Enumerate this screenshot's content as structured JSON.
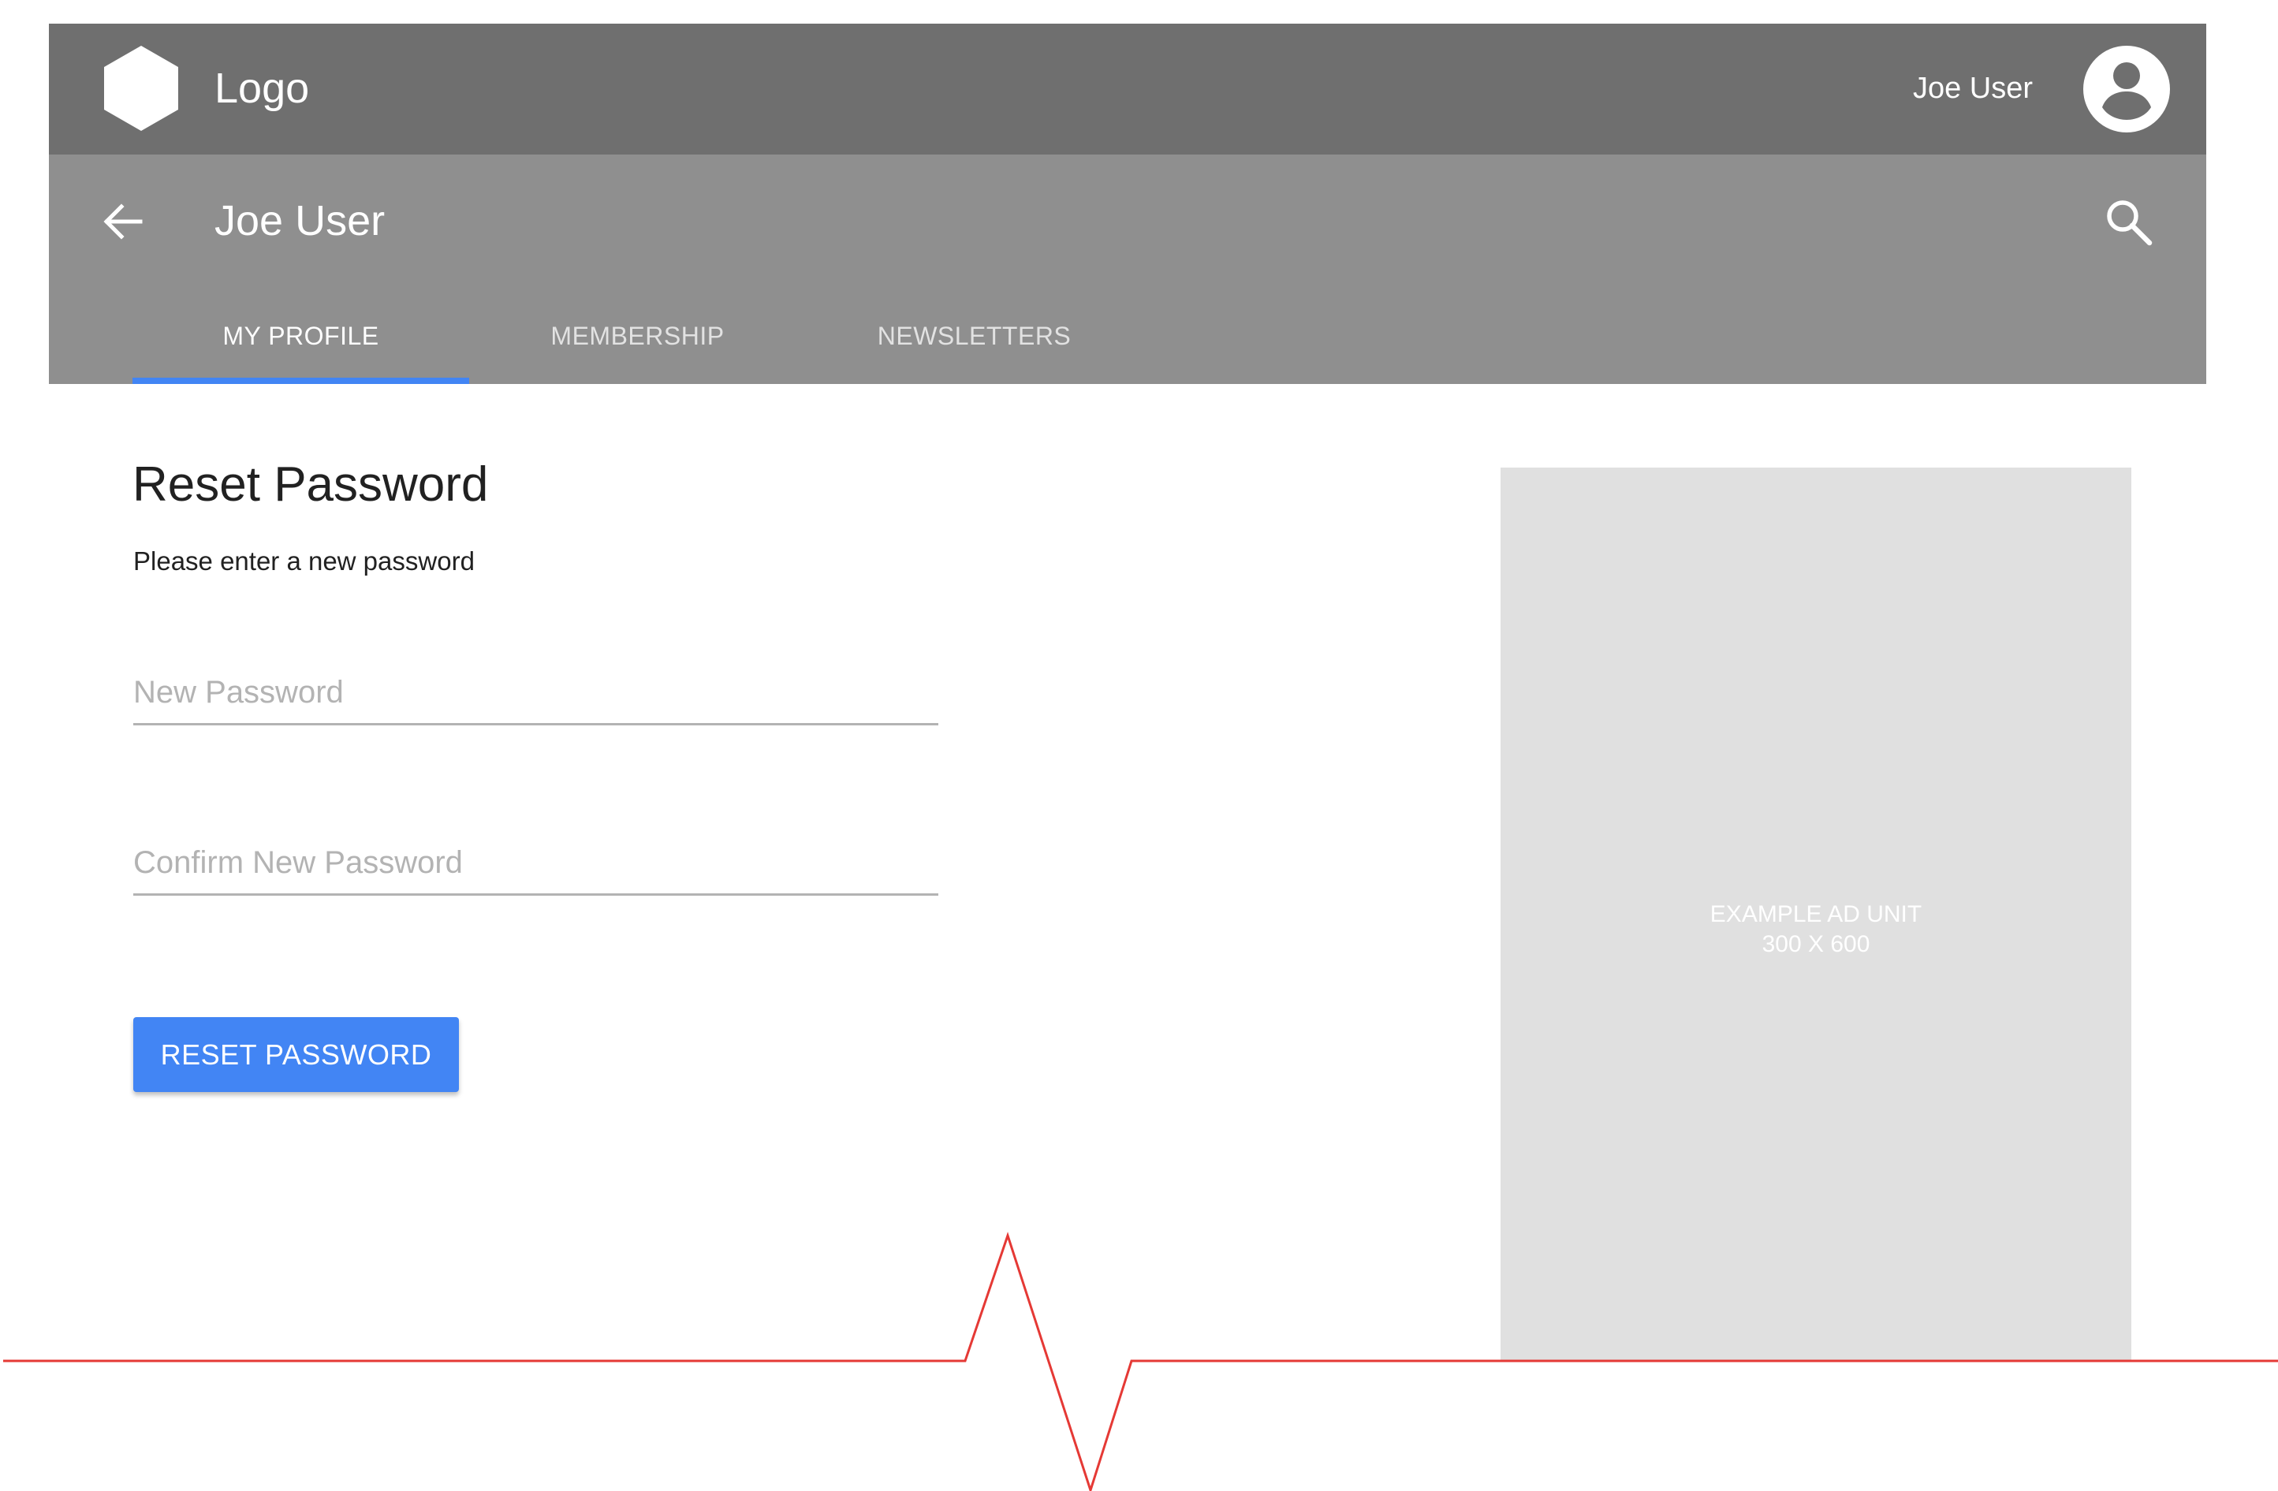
{
  "header": {
    "logo_label": "Logo",
    "user_name": "Joe User"
  },
  "sub_header": {
    "title": "Joe User"
  },
  "tabs": [
    {
      "label": "MY PROFILE",
      "active": true
    },
    {
      "label": "MEMBERSHIP",
      "active": false
    },
    {
      "label": "NEWSLETTERS",
      "active": false
    }
  ],
  "form": {
    "title": "Reset Password",
    "subtitle": "Please enter a new password",
    "new_password_placeholder": "New Password",
    "new_password_value": "",
    "confirm_password_placeholder": "Confirm New Password",
    "confirm_password_value": "",
    "submit_label": "RESET PASSWORD"
  },
  "ad": {
    "line1": "EXAMPLE AD UNIT",
    "line2": "300 X 600"
  },
  "icons": {
    "logo": "hexagon-icon",
    "avatar": "account-circle-icon",
    "back": "arrow-left-icon",
    "search": "search-icon"
  },
  "colors": {
    "top_bar": "#6f6f6f",
    "sub_bar": "#8f8f8f",
    "accent": "#4285f4",
    "ad_background": "#e0e0e0",
    "fold_line": "#e53935"
  }
}
